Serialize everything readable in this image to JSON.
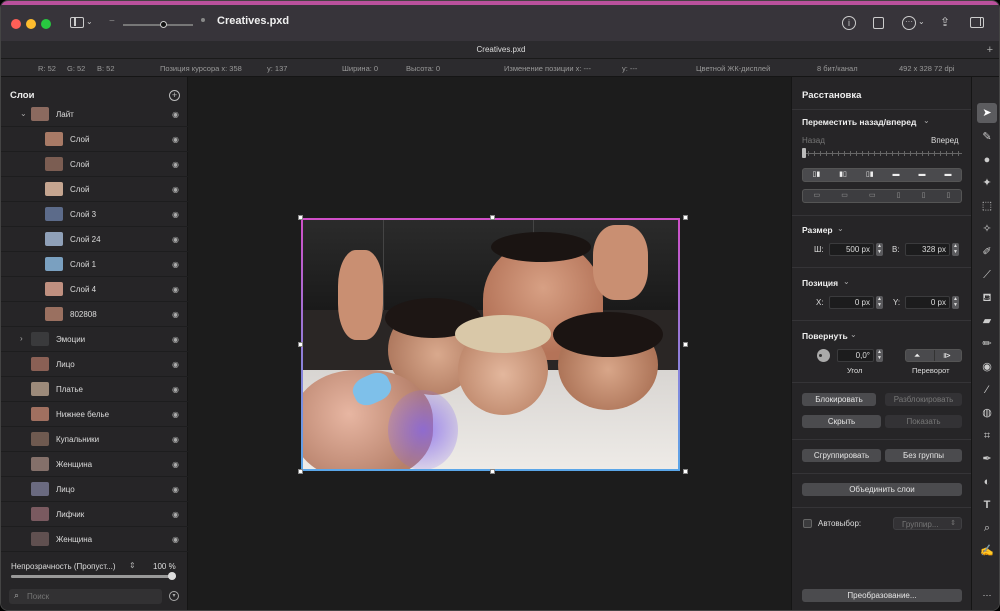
{
  "window": {
    "title": "Creatives.pxd",
    "tab": "Creatives.pxd"
  },
  "infobar": {
    "r": "R: 52",
    "g": "G: 52",
    "b": "B: 52",
    "cursor_x": "Позиция курсора x: 358",
    "cursor_y": "y: 137",
    "width": "Ширина: 0",
    "height": "Высота: 0",
    "pos_change_x": "Изменение позиции x: ---",
    "pos_change_y": "y: ---",
    "display": "Цветной ЖК-дисплей",
    "bits": "8 бит/канал",
    "dims": "492 x 328 72 dpi"
  },
  "layers": {
    "title": "Слои",
    "items": [
      {
        "name": "Лайт",
        "level": 0,
        "expanded": true
      },
      {
        "name": "Слой",
        "level": 1
      },
      {
        "name": "Слой",
        "level": 1
      },
      {
        "name": "Слой",
        "level": 1
      },
      {
        "name": "Слой 3",
        "level": 1
      },
      {
        "name": "Слой 24",
        "level": 1
      },
      {
        "name": "Слой 1",
        "level": 1
      },
      {
        "name": "Слой 4",
        "level": 1
      },
      {
        "name": "802808",
        "level": 1
      },
      {
        "name": "Эмоции",
        "level": 0,
        "collapsed": true
      },
      {
        "name": "Лицо",
        "level": 0
      },
      {
        "name": "Платье",
        "level": 0
      },
      {
        "name": "Нижнее белье",
        "level": 0
      },
      {
        "name": "Купальники",
        "level": 0
      },
      {
        "name": "Женщина",
        "level": 0
      },
      {
        "name": "Лицо",
        "level": 0
      },
      {
        "name": "Лифчик",
        "level": 0
      },
      {
        "name": "Женщина",
        "level": 0
      }
    ],
    "opacity_label": "Непрозрачность (Пропуст...)",
    "opacity_value": "100 %",
    "opacity_level": 1.0,
    "search_placeholder": "Поиск"
  },
  "props": {
    "title": "Расстановка",
    "arrange_title": "Переместить назад/вперед",
    "back_label": "Назад",
    "forward_label": "Вперед",
    "size_title": "Размер",
    "w_label": "Ш:",
    "w_value": "500 px",
    "h_label": "В:",
    "h_value": "328 px",
    "position_title": "Позиция",
    "x_label": "X:",
    "x_value": "0 px",
    "y_label": "Y:",
    "y_value": "0 px",
    "rotate_title": "Повернуть",
    "angle_value": "0,0°",
    "angle_label": "Угол",
    "flip_label": "Переворот",
    "lock_button": "Блокировать",
    "unlock_button": "Разблокировать",
    "hide_button": "Скрыть",
    "show_button": "Показать",
    "group_button": "Сгруппировать",
    "ungroup_button": "Без группы",
    "merge_button": "Объединить слои",
    "autoselect_label": "Автовыбор:",
    "autoselect_value": "Группир...",
    "transform_button": "Преобразование..."
  },
  "colors": {
    "accent": "#b9519c",
    "selection_top": "#d04fc8",
    "selection_bottom": "#5aa6e8"
  }
}
